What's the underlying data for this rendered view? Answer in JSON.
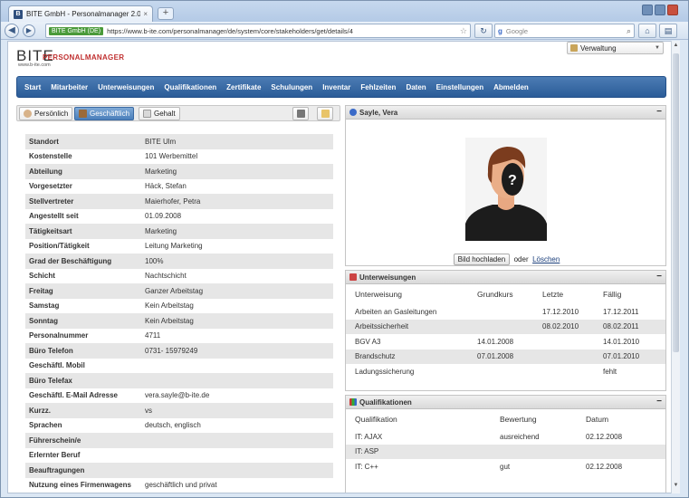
{
  "browser": {
    "tab_title": "BITE GmbH - Personalmanager 2.0",
    "tab_close": "×",
    "new_tab": "+",
    "site_identity": "BITE GmbH (DE)",
    "url": "https://www.b-ite.com/personalmanager/de/system/core/stakeholders/get/details/4",
    "search_engine_badge": "g",
    "search_placeholder": "Google"
  },
  "app": {
    "logo_text": "BITE",
    "logo_product": "PERSONALMANAGER",
    "logo_url": "www.b-ite.com",
    "admin_select": "Verwaltung",
    "menu": [
      "Start",
      "Mitarbeiter",
      "Unterweisungen",
      "Qualifikationen",
      "Zertifikate",
      "Schulungen",
      "Inventar",
      "Fehlzeiten",
      "Daten",
      "Einstellungen",
      "Abmelden"
    ]
  },
  "tabs": {
    "personal": "Persönlich",
    "business": "Geschäftlich",
    "salary": "Gehalt"
  },
  "details": [
    {
      "key": "Standort",
      "value": "BITE Ulm"
    },
    {
      "key": "Kostenstelle",
      "value": "101 Werbemittel"
    },
    {
      "key": "Abteilung",
      "value": "Marketing"
    },
    {
      "key": "Vorgesetzter",
      "value": "Häck, Stefan"
    },
    {
      "key": "Stellvertreter",
      "value": "Maierhofer, Petra"
    },
    {
      "key": "Angestellt seit",
      "value": "01.09.2008"
    },
    {
      "key": "Tätigkeitsart",
      "value": "Marketing"
    },
    {
      "key": "Position/Tätigkeit",
      "value": "Leitung Marketing"
    },
    {
      "key": "Grad der Beschäftigung",
      "value": "100%"
    },
    {
      "key": "Schicht",
      "value": "Nachtschicht"
    },
    {
      "key": "Freitag",
      "value": "Ganzer Arbeitstag"
    },
    {
      "key": "Samstag",
      "value": "Kein Arbeitstag"
    },
    {
      "key": "Sonntag",
      "value": "Kein Arbeitstag"
    },
    {
      "key": "Personalnummer",
      "value": "4711"
    },
    {
      "key": "Büro Telefon",
      "value": "0731- 15979249"
    },
    {
      "key": "Geschäftl. Mobil",
      "value": ""
    },
    {
      "key": "Büro Telefax",
      "value": ""
    },
    {
      "key": "Geschäftl. E-Mail Adresse",
      "value": "vera.sayle@b-ite.de"
    },
    {
      "key": "Kurzz.",
      "value": "vs"
    },
    {
      "key": "Sprachen",
      "value": "deutsch, englisch"
    },
    {
      "key": "Führerschein/e",
      "value": ""
    },
    {
      "key": "Erlernter Beruf",
      "value": ""
    },
    {
      "key": "Beauftragungen",
      "value": ""
    },
    {
      "key": "Nutzung eines Firmenwagens",
      "value": "geschäftlich und privat"
    }
  ],
  "profile": {
    "title": "Sayle, Vera",
    "upload_button": "Bild hochladen",
    "or_text": "oder",
    "delete_link": "Löschen"
  },
  "instructions": {
    "title": "Unterweisungen",
    "headers": [
      "Unterweisung",
      "Grundkurs",
      "Letzte",
      "Fällig"
    ],
    "rows": [
      [
        "Arbeiten an Gasleitungen",
        "",
        "17.12.2010",
        "17.12.2011"
      ],
      [
        "Arbeitssicherheit",
        "",
        "08.02.2010",
        "08.02.2011"
      ],
      [
        "BGV A3",
        "14.01.2008",
        "",
        "14.01.2010"
      ],
      [
        "Brandschutz",
        "07.01.2008",
        "",
        "07.01.2010"
      ],
      [
        "Ladungssicherung",
        "",
        "",
        "fehlt"
      ]
    ]
  },
  "qualifications": {
    "title": "Qualifikationen",
    "headers": [
      "Qualifikation",
      "Bewertung",
      "Datum"
    ],
    "rows": [
      [
        "IT: AJAX",
        "ausreichend",
        "02.12.2008"
      ],
      [
        "IT: ASP",
        "",
        ""
      ],
      [
        "IT: C++",
        "gut",
        "02.12.2008"
      ]
    ]
  }
}
